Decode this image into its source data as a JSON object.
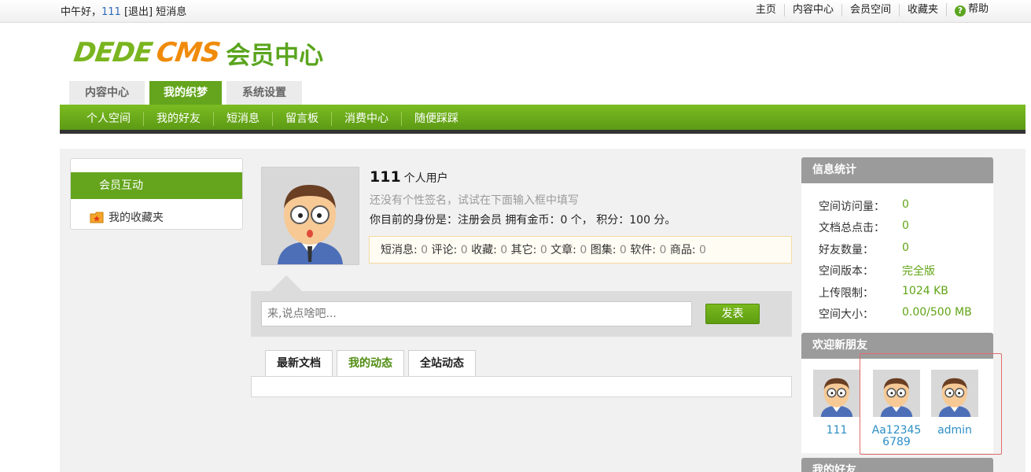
{
  "topbar": {
    "greeting": "中午好，",
    "username": "111",
    "logout": "[退出]",
    "messages": "短消息",
    "links": [
      "主页",
      "内容中心",
      "会员空间",
      "收藏夹",
      "帮助"
    ]
  },
  "logo": {
    "part1": "DEDE",
    "part2": "CMS",
    "part3": "会员中心"
  },
  "main_tabs": [
    "内容中心",
    "我的织梦",
    "系统设置"
  ],
  "sub_nav": [
    "个人空间",
    "我的好友",
    "短消息",
    "留言板",
    "消费中心",
    "随便踩踩"
  ],
  "sidebar": {
    "active_item": "会员互动",
    "item": "我的收藏夹"
  },
  "profile": {
    "uid": "111",
    "user_type": "个人用户",
    "signature": "还没有个性签名，试试在下面输入框中填写",
    "status": "你目前的身份是：注册会员 拥有金币：0 个， 积分：100 分。",
    "stats": [
      {
        "label": "短消息: ",
        "value": "0"
      },
      {
        "label": " 评论: ",
        "value": "0"
      },
      {
        "label": " 收藏: ",
        "value": "0"
      },
      {
        "label": " 其它: ",
        "value": "0"
      },
      {
        "label": " 文章: ",
        "value": "0"
      },
      {
        "label": " 图集: ",
        "value": "0"
      },
      {
        "label": " 软件: ",
        "value": "0"
      },
      {
        "label": " 商品: ",
        "value": "0"
      }
    ]
  },
  "post": {
    "placeholder": "来,说点啥吧...",
    "button": "发表"
  },
  "activity_tabs": [
    "最新文档",
    "我的动态",
    "全站动态"
  ],
  "info": {
    "title": "信息统计",
    "rows": [
      {
        "label": "空间访问量：",
        "value": "0"
      },
      {
        "label": "文档总点击：",
        "value": "0"
      },
      {
        "label": "好友数量：",
        "value": "0"
      },
      {
        "label": "空间版本：",
        "value": "完全版"
      },
      {
        "label": "上传限制：",
        "value": "1024 KB"
      },
      {
        "label": "空间大小：",
        "value": "0.00/500 MB"
      }
    ]
  },
  "new_friends": {
    "title": "欢迎新朋友",
    "friends": [
      "111",
      "Aa123456789",
      "admin"
    ]
  },
  "my_friends": {
    "title": "我的好友"
  },
  "colors": {
    "accent_green": "#64a51d",
    "link_blue": "#2c8ec4",
    "value_green": "#62a417"
  }
}
